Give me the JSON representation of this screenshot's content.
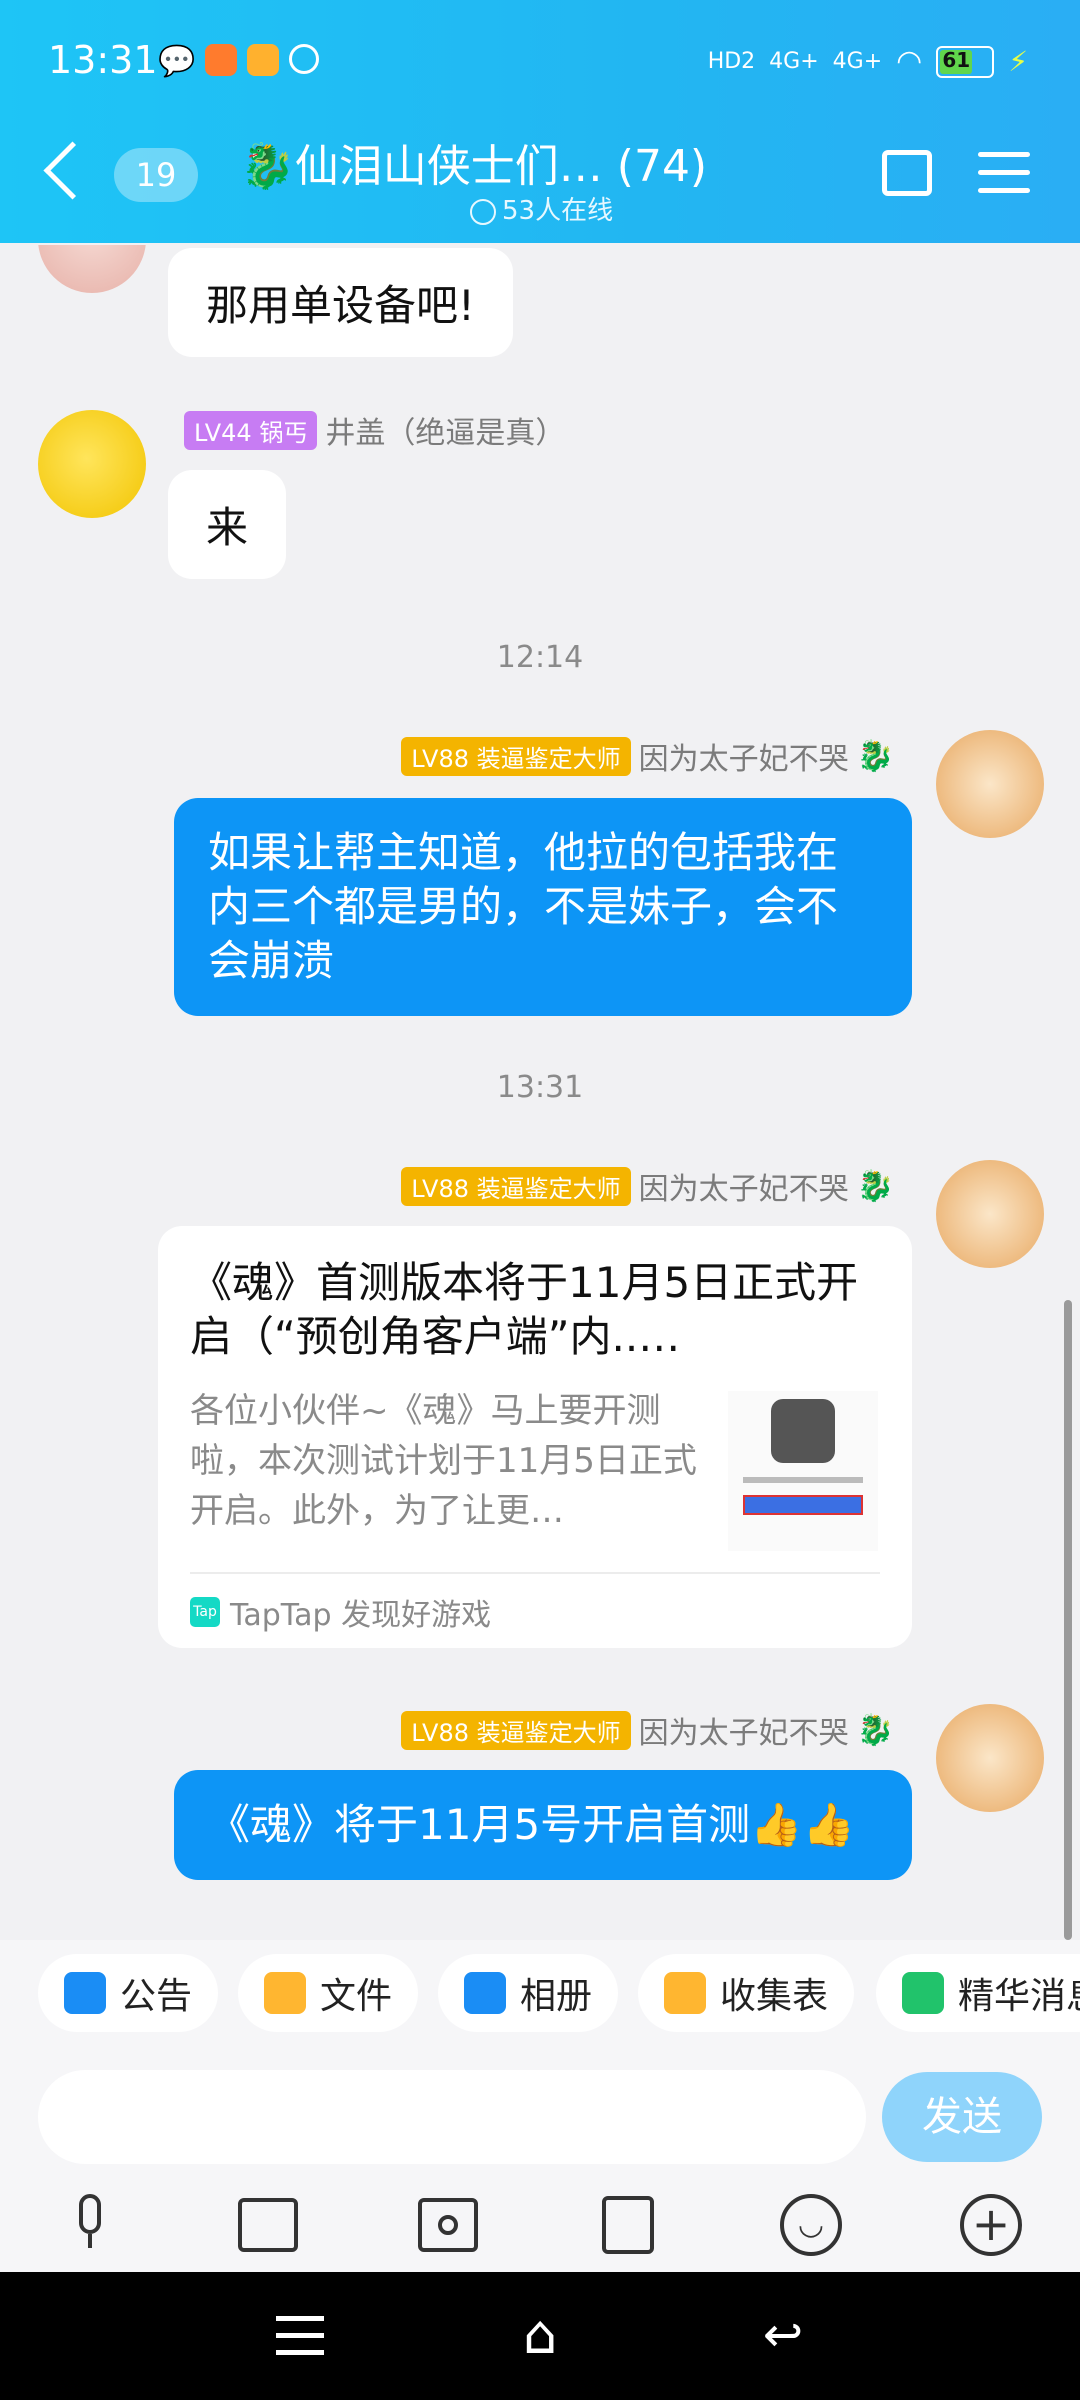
{
  "status_bar": {
    "time": "13:31",
    "battery": "61",
    "network_labels": [
      "HD2",
      "4G+",
      "4G+"
    ]
  },
  "header": {
    "unread_count": "19",
    "group_title": "仙泪山侠士们… (74)",
    "online_text": "53人在线"
  },
  "messages": [
    {
      "text": "那用单设备吧!"
    },
    {
      "level": "LV44",
      "title": "锅丐",
      "sender": "井盖（绝逼是真）",
      "text": "来"
    },
    {
      "time": "12:14"
    },
    {
      "level": "LV88",
      "title": "装逼鉴定大师",
      "sender": "因为太子妃不哭",
      "text": "如果让帮主知道，他拉的包括我在内三个都是男的，不是妹子，会不会崩溃"
    },
    {
      "time": "13:31"
    },
    {
      "level": "LV88",
      "title": "装逼鉴定大师",
      "sender": "因为太子妃不哭",
      "card": {
        "title": "《魂》首测版本将于11月5日正式开启（“预创角客户端”内..…",
        "desc": "各位小伙伴~《魂》马上要开测啦，本次测试计划于11月5日正式开启。此外，为了让更…",
        "source": "TapTap 发现好游戏"
      }
    },
    {
      "level": "LV88",
      "title": "装逼鉴定大师",
      "sender": "因为太子妃不哭",
      "text": "《魂》将于11月5号开启首测👍👍"
    }
  ],
  "quick_actions": [
    "公告",
    "文件",
    "相册",
    "收集表",
    "精华消息"
  ],
  "input": {
    "placeholder": "",
    "send_label": "发送"
  },
  "colors": {
    "header": "#22b6f2",
    "bubble_blue": "#0d95f6",
    "lv_purple": "#c77cf3",
    "lv_gold": "#f4b400"
  }
}
